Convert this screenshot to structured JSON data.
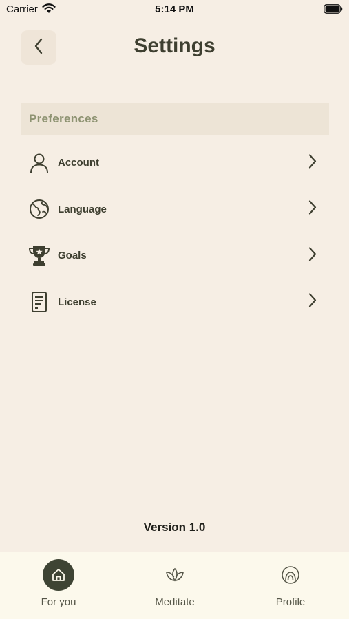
{
  "status_bar": {
    "carrier": "Carrier",
    "time": "5:14 PM"
  },
  "header": {
    "title": "Settings",
    "back_icon": "chevron-left-icon"
  },
  "section": {
    "title": "Preferences"
  },
  "settings": {
    "items": [
      {
        "label": "Account",
        "icon": "person-icon"
      },
      {
        "label": "Language",
        "icon": "globe-icon"
      },
      {
        "label": "Goals",
        "icon": "trophy-icon"
      },
      {
        "label": "License",
        "icon": "document-icon"
      }
    ]
  },
  "footer": {
    "version": "Version 1.0"
  },
  "tab_bar": {
    "tabs": [
      {
        "label": "For you",
        "icon": "home-icon",
        "active": true
      },
      {
        "label": "Meditate",
        "icon": "lotus-icon",
        "active": false
      },
      {
        "label": "Profile",
        "icon": "profile-rings-icon",
        "active": false
      }
    ]
  },
  "colors": {
    "background": "#F6EEE4",
    "text": "#3E3F30",
    "section_header_bg": "#EDE4D6",
    "section_header_text": "#8E9372",
    "tab_bar_bg": "#FCF9EC",
    "active_tab": "#3E4434"
  }
}
